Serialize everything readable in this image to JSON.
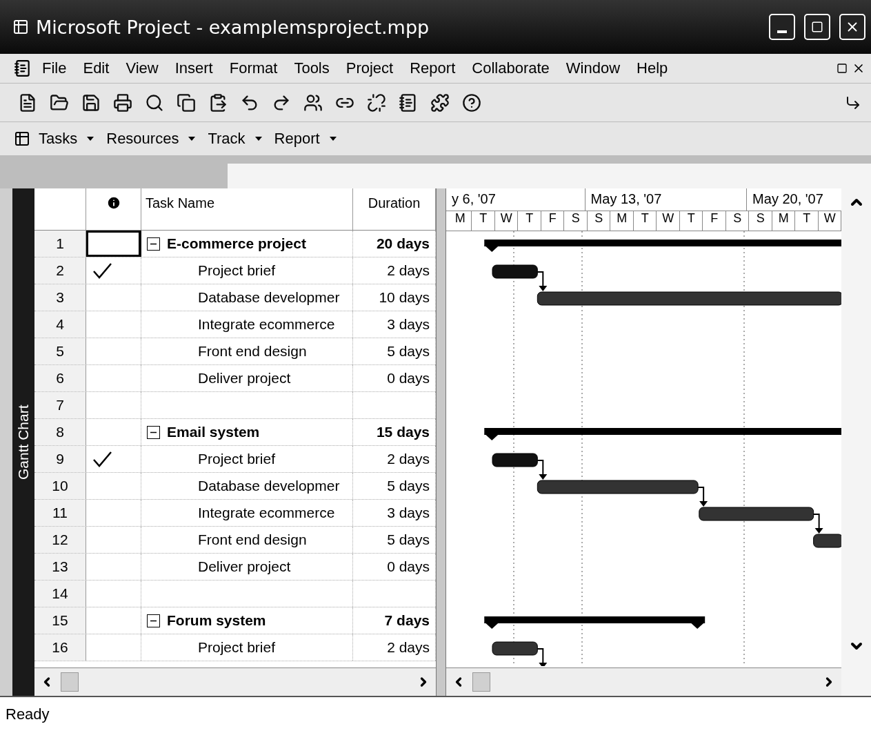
{
  "window": {
    "title": "Microsoft Project - examplemsproject.mpp"
  },
  "menu": [
    "File",
    "Edit",
    "View",
    "Insert",
    "Format",
    "Tools",
    "Project",
    "Report",
    "Collaborate",
    "Window",
    "Help"
  ],
  "view_bar": {
    "items": [
      "Tasks",
      "Resources",
      "Track",
      "Report"
    ]
  },
  "view_label": "Gantt Chart",
  "table": {
    "columns": [
      "Task Name",
      "Duration"
    ],
    "rows": [
      {
        "id": "1",
        "name": "E-commerce project",
        "duration": "20 days",
        "summary": true,
        "expanded": true,
        "completed": false,
        "selected": true
      },
      {
        "id": "2",
        "name": "Project brief",
        "duration": "2 days",
        "summary": false,
        "completed": true,
        "selected": false
      },
      {
        "id": "3",
        "name": "Database developmer",
        "duration": "10 days",
        "summary": false,
        "completed": false,
        "selected": false
      },
      {
        "id": "4",
        "name": "Integrate ecommerce",
        "duration": "3 days",
        "summary": false,
        "completed": false,
        "selected": false
      },
      {
        "id": "5",
        "name": "Front end design",
        "duration": "5 days",
        "summary": false,
        "completed": false,
        "selected": false
      },
      {
        "id": "6",
        "name": "Deliver project",
        "duration": "0 days",
        "summary": false,
        "completed": false,
        "selected": false
      },
      {
        "id": "7",
        "summary": false,
        "completed": false,
        "selected": false
      },
      {
        "id": "8",
        "name": "Email system",
        "duration": "15 days",
        "summary": true,
        "expanded": true,
        "completed": false,
        "selected": false
      },
      {
        "id": "9",
        "name": "Project brief",
        "duration": "2 days",
        "summary": false,
        "completed": true,
        "selected": false
      },
      {
        "id": "10",
        "name": "Database developmer",
        "duration": "5 days",
        "summary": false,
        "completed": false,
        "selected": false
      },
      {
        "id": "11",
        "name": "Integrate ecommerce",
        "duration": "3 days",
        "summary": false,
        "completed": false,
        "selected": false
      },
      {
        "id": "12",
        "name": "Front end design",
        "duration": "5 days",
        "summary": false,
        "completed": false,
        "selected": false
      },
      {
        "id": "13",
        "name": "Deliver project",
        "duration": "0 days",
        "summary": false,
        "completed": false,
        "selected": false
      },
      {
        "id": "14",
        "summary": false,
        "completed": false,
        "selected": false
      },
      {
        "id": "15",
        "name": "Forum system",
        "duration": "7 days",
        "summary": true,
        "expanded": true,
        "completed": false,
        "selected": false
      },
      {
        "id": "16",
        "name": "Project brief",
        "duration": "2 days",
        "summary": false,
        "completed": false,
        "selected": false
      }
    ]
  },
  "timescale": {
    "weeks": [
      "y 6, '07",
      "May 13, '07",
      "May 20, '07"
    ],
    "days": [
      "M",
      "T",
      "W",
      "T",
      "F",
      "S",
      "S",
      "M",
      "T",
      "W",
      "T",
      "F",
      "S",
      "S",
      "M",
      "T",
      "W"
    ]
  },
  "status_bar": "Ready"
}
